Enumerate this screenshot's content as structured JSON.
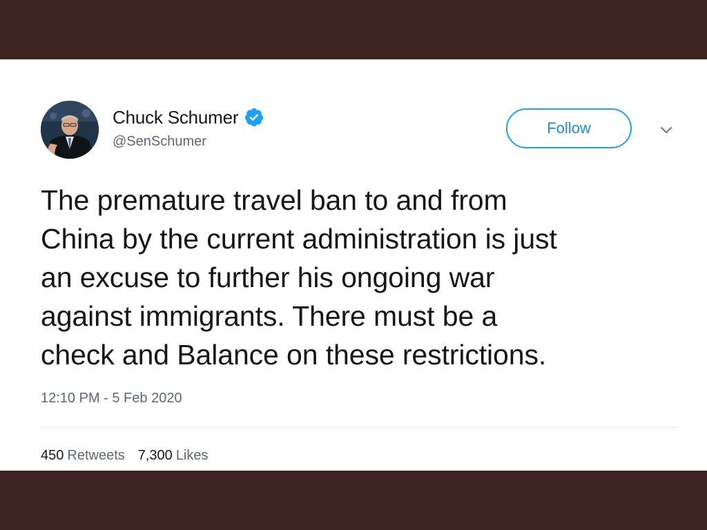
{
  "tweet": {
    "display_name": "Chuck Schumer",
    "handle": "@SenSchumer",
    "verified_icon": "verified-badge-icon",
    "follow_label": "Follow",
    "more_icon": "chevron-down-icon",
    "text_lines": [
      "The premature travel ban to and from",
      "China by the current administration is just",
      "an excuse to further his ongoing war",
      "against immigrants. There must be a",
      "check and Balance on these restrictions."
    ],
    "timestamp": "12:10 PM - 5 Feb 2020",
    "stats": {
      "retweets_count": "450",
      "retweets_label": "Retweets",
      "likes_count": "7,300",
      "likes_label": "Likes"
    }
  },
  "colors": {
    "accent": "#1da1f2",
    "frame": "#3d2422",
    "text": "#14171a",
    "muted": "#5b6873"
  }
}
